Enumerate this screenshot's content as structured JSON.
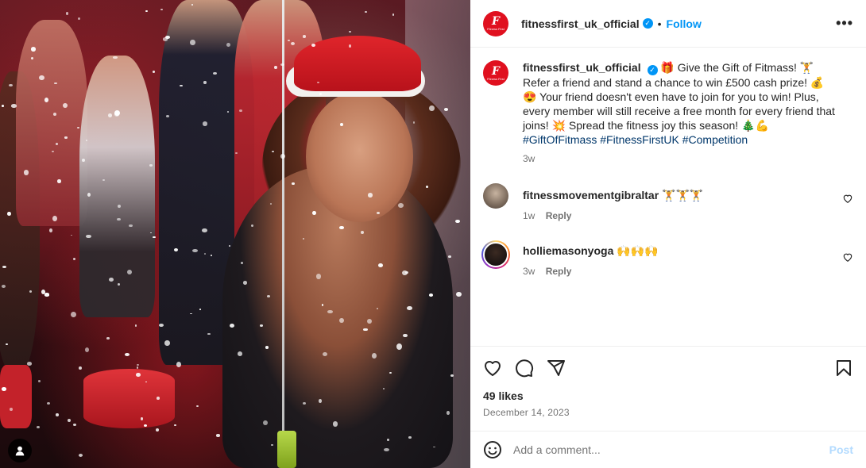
{
  "post": {
    "username": "fitnessfirst_uk_official",
    "verified": true,
    "follow_label": "Follow",
    "separator": "•",
    "more_label": "•••",
    "logo_letter": "F",
    "logo_text": "Fitness First"
  },
  "caption": {
    "username": "fitnessfirst_uk_official",
    "text_part1": "🎁 Give the Gift of Fitmass! 🏋️ Refer a friend and stand a chance to win £500 cash prize! 💰 😍 Your friend doesn't even have to join for you to win! Plus, every member will still receive a free month for every friend that joins! 💥 Spread the fitness joy this season! 🎄💪 ",
    "hashtags": [
      "#GiftOfFitmass",
      "#FitnessFirstUK",
      "#Competition"
    ],
    "time": "3w"
  },
  "comments": [
    {
      "username": "fitnessmovementgibraltar",
      "text": "🏋️🏋️🏋️",
      "time": "1w",
      "reply_label": "Reply"
    },
    {
      "username": "holliemasonyoga",
      "text": "🙌🙌🙌",
      "time": "3w",
      "reply_label": "Reply"
    }
  ],
  "engagement": {
    "likes": "49 likes",
    "date": "December 14, 2023"
  },
  "comment_box": {
    "placeholder": "Add a comment...",
    "post_label": "Post"
  },
  "icons": {
    "like": "heart-icon",
    "comment": "comment-icon",
    "share": "share-icon",
    "save": "bookmark-icon",
    "emoji": "emoji-icon",
    "tag": "user-tag-icon"
  },
  "colors": {
    "accent": "#0095f6",
    "brand": "#e0101f",
    "hashtag": "#00376b",
    "muted": "#737373"
  }
}
